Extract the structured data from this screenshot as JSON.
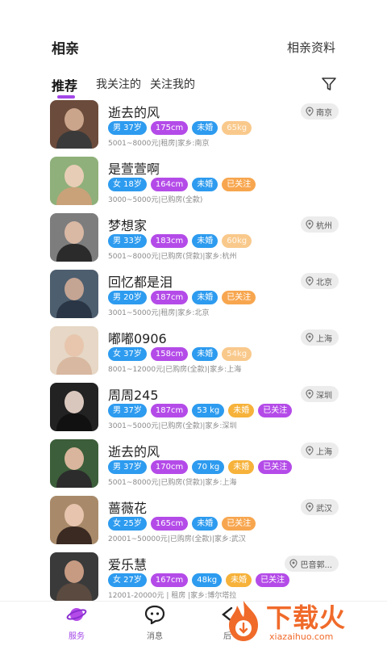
{
  "header": {
    "title": "相亲",
    "right_link": "相亲资料"
  },
  "tabs": [
    {
      "label": "推荐",
      "active": true
    },
    {
      "label": "我关注的",
      "active": false
    },
    {
      "label": "关注我的",
      "active": false
    }
  ],
  "filter_icon": "filter-icon",
  "profiles": [
    {
      "name": "逝去的风",
      "gender_age": "男 37岁",
      "height": "175cm",
      "marital": "未婚",
      "weight": "65kg",
      "weight_faded": true,
      "followed": "",
      "location": "南京",
      "info": "5001~8000元|租房|家乡:南京"
    },
    {
      "name": "是萱萱啊",
      "gender_age": "女 18岁",
      "height": "164cm",
      "marital": "未婚",
      "weight": "",
      "weight_faded": false,
      "followed": "已关注",
      "location": "",
      "info": "3000~5000元|已购房(全款)"
    },
    {
      "name": "梦想家",
      "gender_age": "男 33岁",
      "height": "183cm",
      "marital": "未婚",
      "weight": "60kg",
      "weight_faded": true,
      "followed": "",
      "location": "杭州",
      "info": "5001~8000元|已购房(贷款)|家乡:杭州"
    },
    {
      "name": "回忆都是泪",
      "gender_age": "男 20岁",
      "height": "187cm",
      "marital": "未婚",
      "weight": "",
      "weight_faded": false,
      "followed": "已关注",
      "location": "北京",
      "info": "3001~5000元|租房|家乡:北京"
    },
    {
      "name": "嘟嘟0906",
      "gender_age": "女 37岁",
      "height": "158cm",
      "marital": "未婚",
      "weight": "54kg",
      "weight_faded": true,
      "followed": "",
      "location": "上海",
      "info": "8001~12000元|已购房(全款)|家乡:上海"
    },
    {
      "name": "周周245",
      "gender_age": "男 37岁",
      "height": "187cm",
      "marital": "53 kg",
      "weight": "未婚",
      "weight_faded": false,
      "followed": "已关注",
      "location": "深圳",
      "info": "3001~5000元|已购房(全款)|家乡:深圳",
      "alt_layout": true
    },
    {
      "name": "逝去的风",
      "gender_age": "男 37岁",
      "height": "170cm",
      "marital": "70 kg",
      "weight": "未婚",
      "weight_faded": false,
      "followed": "已关注",
      "location": "上海",
      "info": "5001~8000元|已购房(贷款)|家乡:上海",
      "alt_layout": true
    },
    {
      "name": "蔷薇花",
      "gender_age": "女 25岁",
      "height": "165cm",
      "marital": "未婚",
      "weight": "",
      "weight_faded": false,
      "followed": "已关注",
      "location": "武汉",
      "info": "20001~50000元|已购房(全款)|家乡:武汉"
    },
    {
      "name": "爱乐慧",
      "gender_age": "女 27岁",
      "height": "167cm",
      "marital": "48kg",
      "weight": "未婚",
      "weight_faded": false,
      "followed": "已关注",
      "location": "巴音郭...",
      "info": "12001-20000元 | 租房 |家乡:博尔塔拉",
      "alt_layout": true
    }
  ],
  "tabbar": [
    {
      "label": "服务",
      "icon": "planet-icon",
      "active": true
    },
    {
      "label": "消息",
      "icon": "chat-bubble-icon",
      "active": false
    },
    {
      "label": "后",
      "icon": "back-arrow-icon",
      "active": false
    }
  ],
  "watermark": {
    "text": "下载火",
    "sub": "xiazaihuo.com"
  },
  "colors": {
    "accent": "#a347e8",
    "blue_tag": "#2d9bef",
    "purple_tag": "#b44be8",
    "orange_tag": "#f7a64f",
    "watermark": "#f06a2a"
  }
}
